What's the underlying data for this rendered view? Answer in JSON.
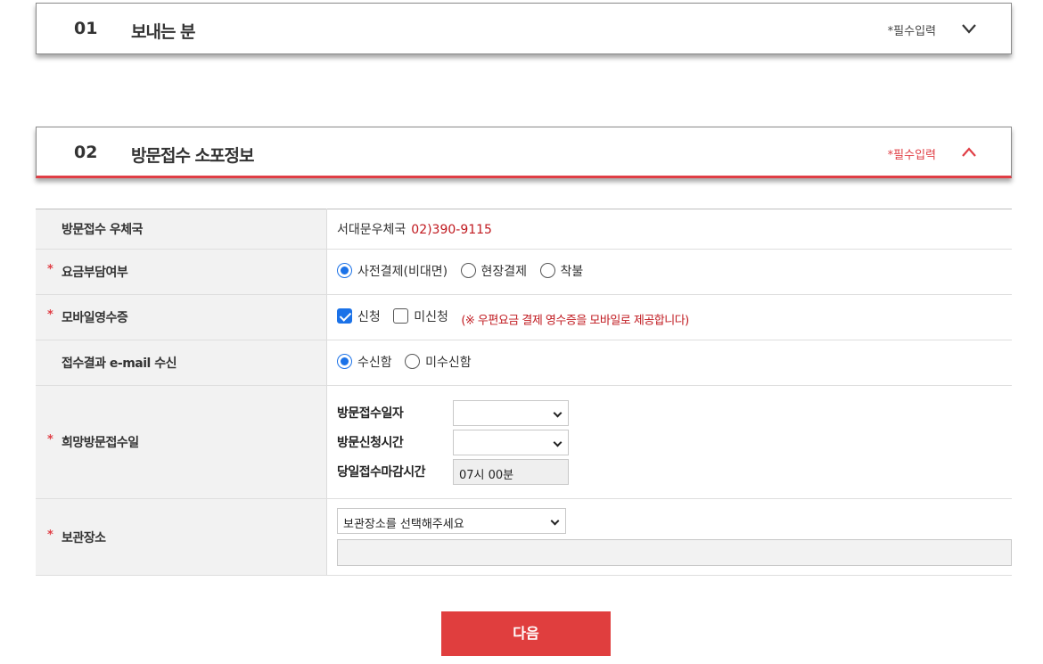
{
  "section1": {
    "num": "01",
    "title": "보내는 분",
    "required_star": "*",
    "required_note": "필수입력"
  },
  "section2": {
    "num": "02",
    "title": "방문접수 소포정보",
    "required_star": "*",
    "required_note": "필수입력"
  },
  "colors": {
    "accent": "#e03e45",
    "checked": "#1b72e8",
    "phone": "#c0191f"
  },
  "form": {
    "required_mark": "*",
    "office": {
      "label": "방문접수 우체국",
      "name": "서대문우체국",
      "phone": "02)390-9115"
    },
    "fee": {
      "label": "요금부담여부",
      "options": [
        "사전결제(비대면)",
        "현장결제",
        "착불"
      ],
      "selected": "사전결제(비대면)"
    },
    "receipt": {
      "label": "모바일영수증",
      "options": [
        "신청",
        "미신청"
      ],
      "checked": "신청",
      "notice": "(※ 우편요금 결제 영수증을 모바일로 제공합니다)"
    },
    "email": {
      "label": "접수결과 e-mail 수신",
      "options": [
        "수신함",
        "미수신함"
      ],
      "selected": "수신함"
    },
    "visit": {
      "label": "희망방문접수일",
      "date_label": "방문접수일자",
      "date_value": "",
      "time_label": "방문신청시간",
      "time_value": "",
      "deadline_label": "당일접수마감시간",
      "deadline_value": "07시 00분"
    },
    "storage": {
      "label": "보관장소",
      "placeholder": "보관장소를 선택해주세요",
      "detail_value": ""
    }
  },
  "buttons": {
    "next": "다음"
  }
}
